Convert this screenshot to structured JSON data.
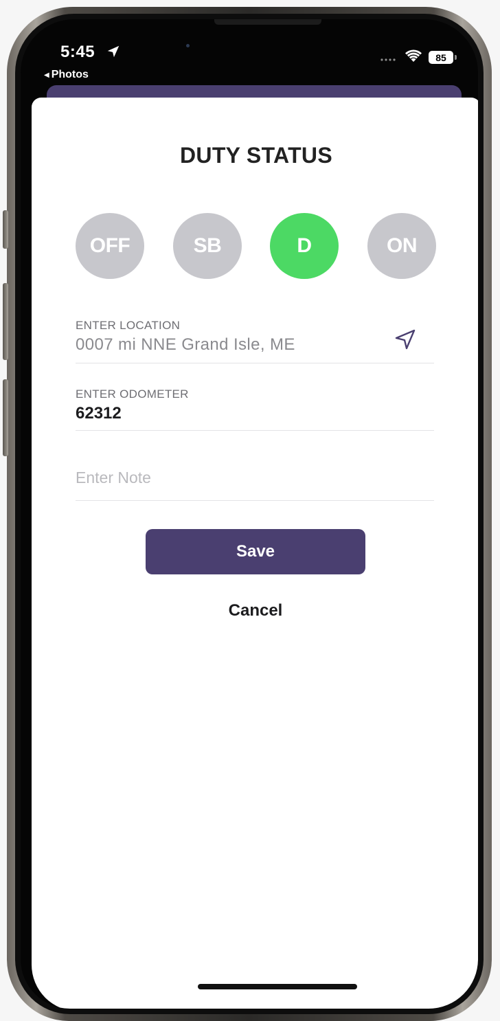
{
  "status_bar": {
    "time": "5:45",
    "back_app": "Photos",
    "battery": "85"
  },
  "modal": {
    "title": "DUTY STATUS",
    "statuses": [
      {
        "label": "OFF",
        "active": false
      },
      {
        "label": "SB",
        "active": false
      },
      {
        "label": "D",
        "active": true
      },
      {
        "label": "ON",
        "active": false
      }
    ],
    "location": {
      "label": "ENTER LOCATION",
      "value": "0007 mi NNE Grand Isle, ME"
    },
    "odometer": {
      "label": "ENTER ODOMETER",
      "value": "62312"
    },
    "note": {
      "placeholder": "Enter Note"
    },
    "save_label": "Save",
    "cancel_label": "Cancel"
  },
  "colors": {
    "accent": "#4a3f70",
    "active_status": "#4cd964",
    "inactive_status": "#c7c7cc"
  },
  "icons": [
    "location-arrow-icon",
    "wifi-icon",
    "navigation-icon"
  ]
}
